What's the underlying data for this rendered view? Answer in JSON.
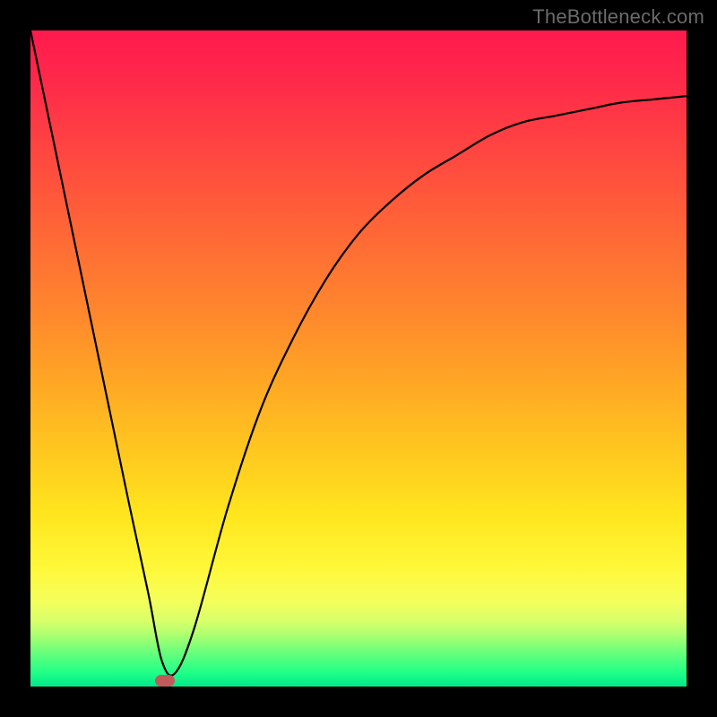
{
  "watermark": "TheBottleneck.com",
  "chart_data": {
    "type": "line",
    "title": "",
    "xlabel": "",
    "ylabel": "",
    "xlim": [
      0,
      100
    ],
    "ylim": [
      0,
      100
    ],
    "grid": false,
    "legend": false,
    "series": [
      {
        "name": "bottleneck-curve",
        "x": [
          0,
          5,
          10,
          15,
          18,
          20,
          22,
          25,
          30,
          35,
          40,
          45,
          50,
          55,
          60,
          65,
          70,
          75,
          80,
          85,
          90,
          95,
          100
        ],
        "values": [
          100,
          76,
          52,
          28,
          14,
          4,
          2,
          9,
          27,
          42,
          53,
          62,
          69,
          74,
          78,
          81,
          84,
          86,
          87,
          88,
          89,
          89.5,
          90
        ]
      }
    ],
    "marker": {
      "x": 20.5,
      "y": 1
    },
    "colors": {
      "top": "#ff1a4d",
      "mid_upper": "#ff8a2c",
      "mid_lower": "#ffe61e",
      "bottom": "#00e88a",
      "curve": "#000000",
      "marker": "#c15a5a",
      "frame": "#000000"
    }
  }
}
